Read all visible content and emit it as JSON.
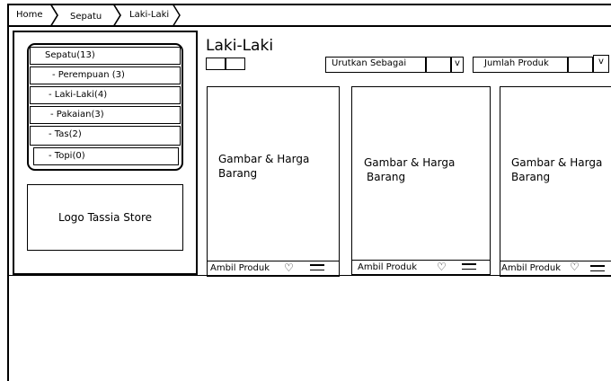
{
  "breadcrumb": [
    "Home",
    "Sepatu",
    "Laki-Laki"
  ],
  "sidebar": {
    "categories": [
      "Sepatu(13)",
      "- Perempuan (3)",
      "- Laki-Laki(4)",
      "- Pakaian(3)",
      "- Tas(2)",
      "- Topi(0)"
    ],
    "logo": "Logo Tassia Store"
  },
  "main": {
    "title": "Laki-Laki",
    "sort_label": "Urutkan Sebagai",
    "count_label": "Jumlah Produk",
    "chevron": "v"
  },
  "cards": [
    {
      "line1": "Gambar & Harga",
      "line2": "Barang",
      "action": "Ambil Produk"
    },
    {
      "line1": "Gambar & Harga",
      "line2": "Barang",
      "action": "Ambil Produk"
    },
    {
      "line1": "Gambar & Harga",
      "line2": "Barang",
      "action": "Ambil Produk"
    }
  ],
  "icons": {
    "heart": "♡"
  }
}
